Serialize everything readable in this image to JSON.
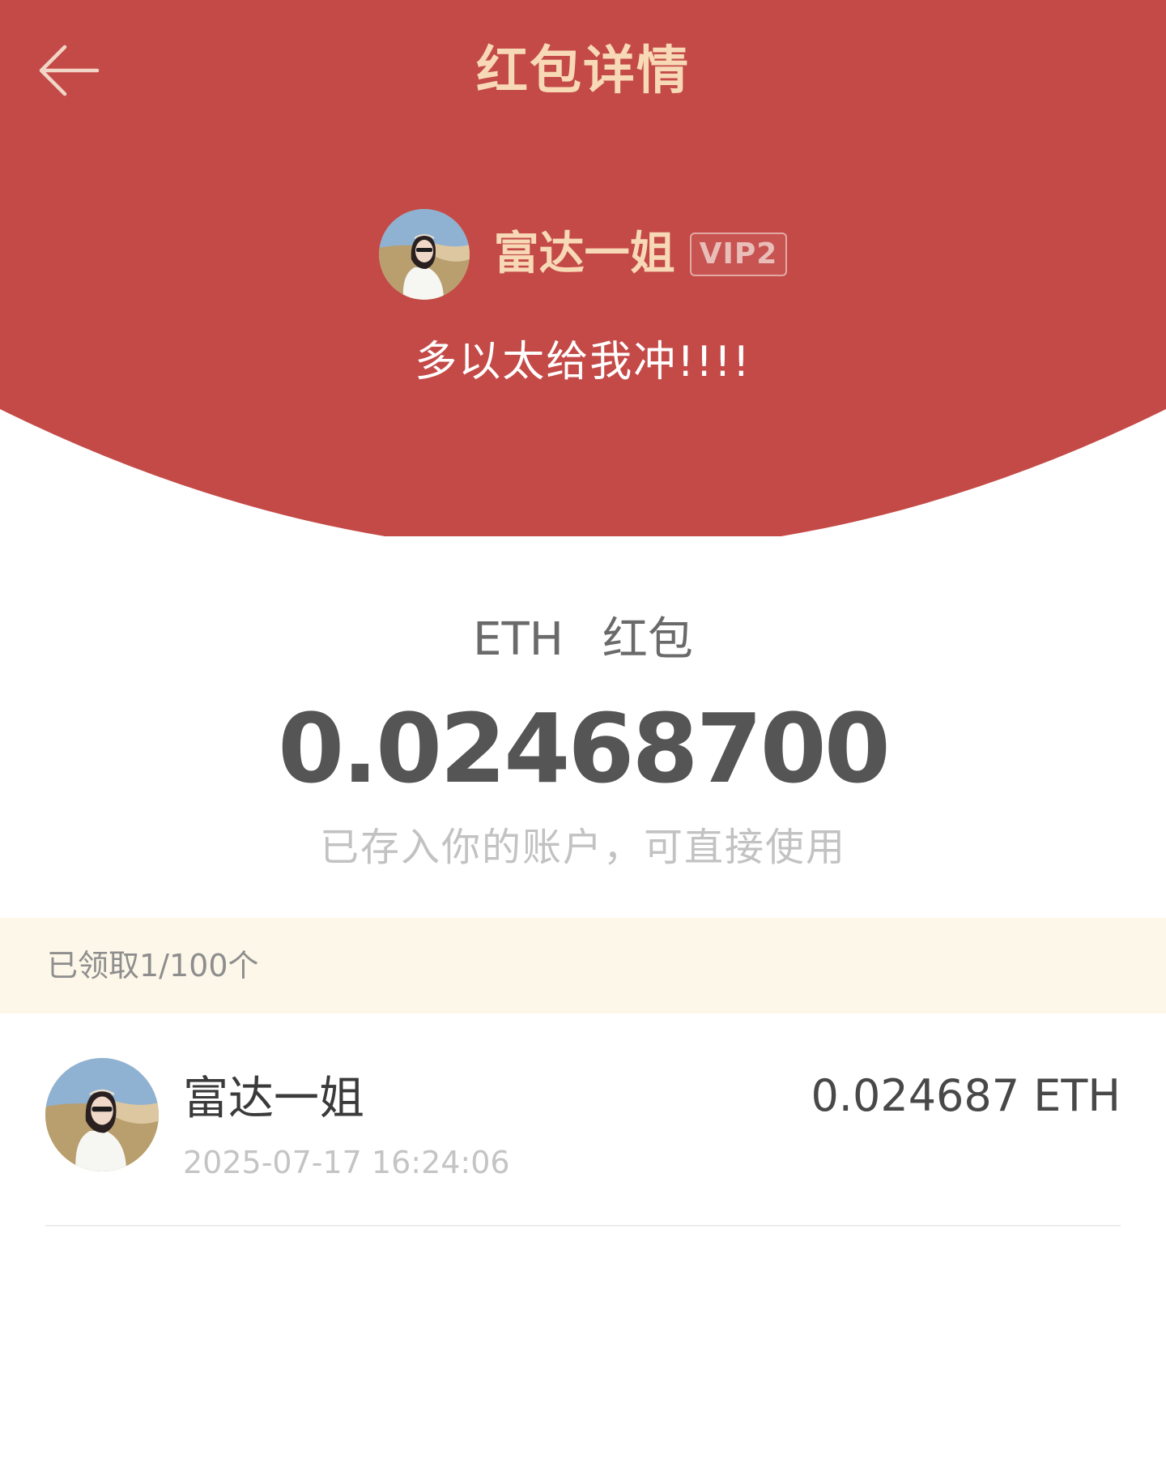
{
  "header": {
    "title": "红包详情",
    "back_icon": "arrow-left-icon",
    "background_color": "#c44a47",
    "title_color": "#f7d9b5"
  },
  "sender": {
    "name": "富达一姐",
    "vip_badge": "VIP2",
    "avatar_icon": "user-avatar",
    "greeting": "多以太给我冲!!!!"
  },
  "red_packet": {
    "coin": "ETH",
    "label": "红包",
    "amount": "0.02468700",
    "note": "已存入你的账户，可直接使用"
  },
  "claimed": {
    "summary": "已领取1/100个"
  },
  "records": [
    {
      "name": "富达一姐",
      "time": "2025-07-17 16:24:06",
      "amount": "0.024687 ETH"
    }
  ]
}
